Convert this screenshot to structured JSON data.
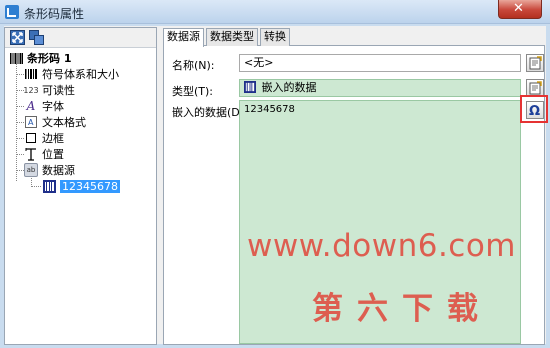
{
  "window": {
    "title": "条形码属性",
    "close_icon": "close-icon"
  },
  "tree_toolbar": {
    "buttons": [
      "expand-icon",
      "collapse-icon"
    ]
  },
  "tree": {
    "root": {
      "label": "条形码 1",
      "icon": "barcode-icon"
    },
    "items": [
      {
        "label": "符号体系和大小",
        "icon": "barcode-symbology-icon"
      },
      {
        "label": "可读性",
        "icon": "readability-icon",
        "icon_text": "123"
      },
      {
        "label": "字体",
        "icon": "font-icon",
        "icon_text": "A"
      },
      {
        "label": "文本格式",
        "icon": "text-format-icon"
      },
      {
        "label": "边框",
        "icon": "border-icon"
      },
      {
        "label": "位置",
        "icon": "position-icon"
      },
      {
        "label": "数据源",
        "icon": "data-source-icon",
        "icon_text": "ab"
      }
    ],
    "child": {
      "label": "12345678",
      "icon": "embedded-data-icon",
      "selected": true
    }
  },
  "tabs": [
    {
      "label": "数据源",
      "active": true
    },
    {
      "label": "数据类型",
      "active": false
    },
    {
      "label": "转换",
      "active": false
    }
  ],
  "form": {
    "name_label": "名称(N):",
    "name_value": "<无>",
    "type_label": "类型(T):",
    "type_value": "嵌入的数据",
    "embedded_label": "嵌入的数据(D):",
    "embedded_value": "12345678"
  },
  "watermark": {
    "url": "www.down6.com",
    "cn": "第六下载"
  },
  "colors": {
    "green_field": "#cde8d2",
    "selection": "#3399ff",
    "highlight": "#e53333",
    "watermark": "#e0463a"
  }
}
